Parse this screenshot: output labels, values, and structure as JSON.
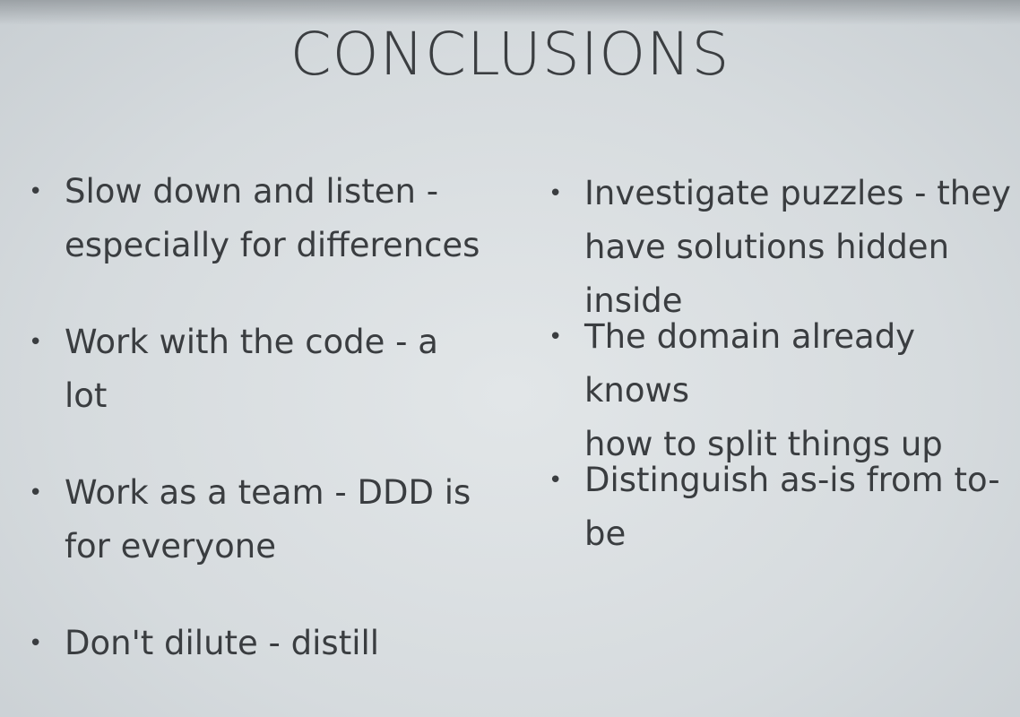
{
  "slide": {
    "title": "CONCLUSIONS",
    "left_bullets": [
      "Slow down and listen -\nespecially for differences",
      "Work with the code - a\nlot",
      "Work as a team - DDD is\nfor everyone",
      "Don't dilute - distill"
    ],
    "right_bullets": [
      "Investigate puzzles - they\nhave solutions hidden inside",
      "The domain already knows\nhow to split things up",
      "Distinguish as-is from to-be"
    ],
    "bullet_glyph": "•"
  }
}
